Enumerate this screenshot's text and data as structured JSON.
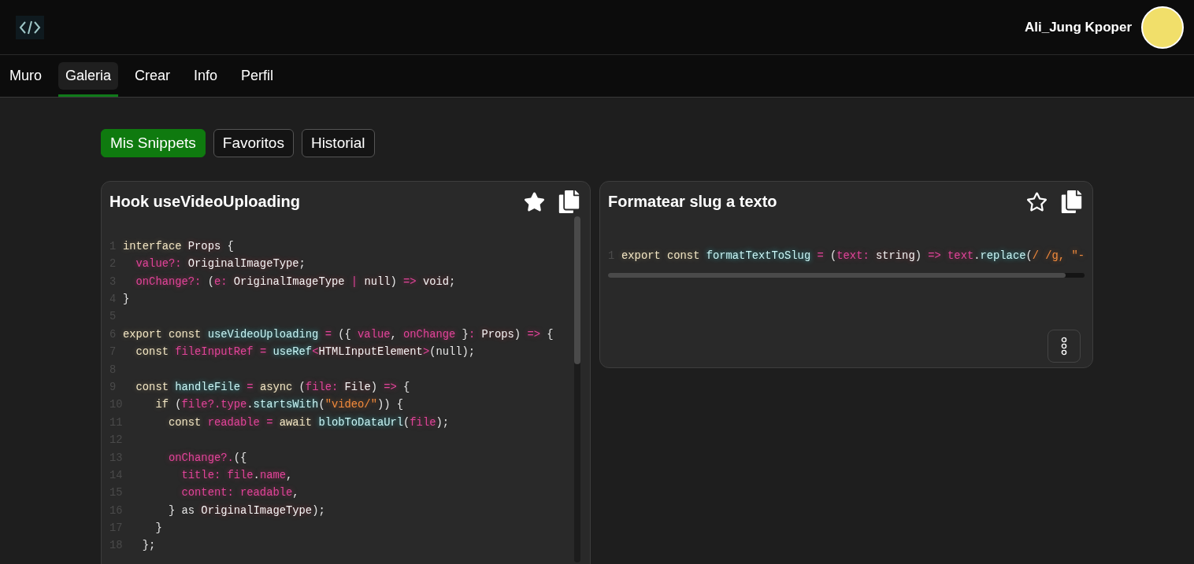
{
  "header": {
    "username": "Ali_Jung Kpoper"
  },
  "nav": [
    {
      "label": "Muro",
      "selected": false
    },
    {
      "label": "Galeria",
      "selected": true
    },
    {
      "label": "Crear",
      "selected": false
    },
    {
      "label": "Info",
      "selected": false
    },
    {
      "label": "Perfil",
      "selected": false
    }
  ],
  "filters": [
    {
      "label": "Mis Snippets",
      "selected": true
    },
    {
      "label": "Favoritos",
      "selected": false
    },
    {
      "label": "Historial",
      "selected": false
    }
  ],
  "snippets": [
    {
      "title": "Hook useVideoUploading",
      "favorite": true,
      "kind": "vertical",
      "lines": [
        {
          "number": "1",
          "tokens": [
            {
              "text": "interface ",
              "kind": "keyword"
            },
            {
              "text": "Props",
              "kind": "type"
            },
            {
              "text": " {",
              "kind": "punctuation"
            }
          ]
        },
        {
          "number": "2",
          "tokens": [
            {
              "text": "  value?: ",
              "kind": "variable"
            },
            {
              "text": "OriginalImageType",
              "kind": "type"
            },
            {
              "text": ";",
              "kind": "punctuation"
            }
          ]
        },
        {
          "number": "3",
          "tokens": [
            {
              "text": "  onChange?: ",
              "kind": "variable"
            },
            {
              "text": "(",
              "kind": "punctuation"
            },
            {
              "text": "e: ",
              "kind": "variable"
            },
            {
              "text": "OriginalImageType",
              "kind": "type"
            },
            {
              "text": " | ",
              "kind": "variable"
            },
            {
              "text": "null",
              "kind": "type"
            },
            {
              "text": ") ",
              "kind": "punctuation"
            },
            {
              "text": "=> ",
              "kind": "variable"
            },
            {
              "text": "void",
              "kind": "type"
            },
            {
              "text": ";",
              "kind": "punctuation"
            }
          ]
        },
        {
          "number": "4",
          "tokens": [
            {
              "text": "}",
              "kind": "punctuation"
            }
          ]
        },
        {
          "number": "5"
        },
        {
          "number": "6",
          "tokens": [
            {
              "text": "export const ",
              "kind": "keyword"
            },
            {
              "text": "useVideoUploading",
              "kind": "function"
            },
            {
              "text": " = ",
              "kind": "variable"
            },
            {
              "text": "({ ",
              "kind": "punctuation"
            },
            {
              "text": "value",
              "kind": "variable"
            },
            {
              "text": ", ",
              "kind": "punctuation"
            },
            {
              "text": "onChange",
              "kind": "variable"
            },
            {
              "text": " }",
              "kind": "punctuation"
            },
            {
              "text": ": ",
              "kind": "variable"
            },
            {
              "text": "Props",
              "kind": "type"
            },
            {
              "text": ") ",
              "kind": "punctuation"
            },
            {
              "text": "=>",
              "kind": "variable"
            },
            {
              "text": " {",
              "kind": "punctuation"
            }
          ]
        },
        {
          "number": "7",
          "tokens": [
            {
              "text": "  const ",
              "kind": "keyword"
            },
            {
              "text": "fileInputRef",
              "kind": "variable"
            },
            {
              "text": " = ",
              "kind": "variable"
            },
            {
              "text": "useRef",
              "kind": "function"
            },
            {
              "text": "<",
              "kind": "variable"
            },
            {
              "text": "HTMLInputElement",
              "kind": "type"
            },
            {
              "text": ">",
              "kind": "variable"
            },
            {
              "text": "(null);",
              "kind": "punctuation"
            }
          ]
        },
        {
          "number": "8"
        },
        {
          "number": "9",
          "tokens": [
            {
              "text": "  const ",
              "kind": "keyword"
            },
            {
              "text": "handleFile",
              "kind": "function"
            },
            {
              "text": " = ",
              "kind": "variable"
            },
            {
              "text": "async",
              "kind": "keyword"
            },
            {
              "text": " (",
              "kind": "punctuation"
            },
            {
              "text": "file: ",
              "kind": "variable"
            },
            {
              "text": "File",
              "kind": "type"
            },
            {
              "text": ") ",
              "kind": "punctuation"
            },
            {
              "text": "=>",
              "kind": "variable"
            },
            {
              "text": " {",
              "kind": "punctuation"
            }
          ]
        },
        {
          "number": "10",
          "tokens": [
            {
              "text": "     if",
              "kind": "keyword"
            },
            {
              "text": " (",
              "kind": "punctuation"
            },
            {
              "text": "file?.type",
              "kind": "variable"
            },
            {
              "text": ".",
              "kind": "punctuation"
            },
            {
              "text": "startsWith",
              "kind": "function"
            },
            {
              "text": "(",
              "kind": "punctuation"
            },
            {
              "text": "\"video/\"",
              "kind": "string"
            },
            {
              "text": ")) {",
              "kind": "punctuation"
            }
          ]
        },
        {
          "number": "11",
          "tokens": [
            {
              "text": "       const ",
              "kind": "keyword"
            },
            {
              "text": "readable",
              "kind": "variable"
            },
            {
              "text": " = ",
              "kind": "variable"
            },
            {
              "text": "await ",
              "kind": "keyword"
            },
            {
              "text": "blobToDataUrl",
              "kind": "function"
            },
            {
              "text": "(",
              "kind": "punctuation"
            },
            {
              "text": "file",
              "kind": "variable"
            },
            {
              "text": ");",
              "kind": "punctuation"
            }
          ]
        },
        {
          "number": "12"
        },
        {
          "number": "13",
          "tokens": [
            {
              "text": "       onChange?.",
              "kind": "variable"
            },
            {
              "text": "({",
              "kind": "punctuation"
            }
          ]
        },
        {
          "number": "14",
          "tokens": [
            {
              "text": "         title: file",
              "kind": "variable"
            },
            {
              "text": ".",
              "kind": "punctuation"
            },
            {
              "text": "name",
              "kind": "variable"
            },
            {
              "text": ",",
              "kind": "punctuation"
            }
          ]
        },
        {
          "number": "15",
          "tokens": [
            {
              "text": "         content: readable",
              "kind": "variable"
            },
            {
              "text": ",",
              "kind": "punctuation"
            }
          ]
        },
        {
          "number": "16",
          "tokens": [
            {
              "text": "       } as ",
              "kind": "punctuation"
            },
            {
              "text": "OriginalImageType",
              "kind": "type"
            },
            {
              "text": ");",
              "kind": "punctuation"
            }
          ]
        },
        {
          "number": "17",
          "tokens": [
            {
              "text": "     }",
              "kind": "punctuation"
            }
          ]
        },
        {
          "number": "18",
          "tokens": [
            {
              "text": "   };",
              "kind": "punctuation"
            }
          ]
        }
      ]
    },
    {
      "title": "Formatear slug a texto",
      "favorite": false,
      "kind": "horizontal",
      "lines": [
        {
          "number": "1",
          "tokens": [
            {
              "text": "export const ",
              "kind": "keyword"
            },
            {
              "text": "formatTextToSlug",
              "kind": "function"
            },
            {
              "text": " = ",
              "kind": "variable"
            },
            {
              "text": "(",
              "kind": "punctuation"
            },
            {
              "text": "text: ",
              "kind": "variable"
            },
            {
              "text": "string",
              "kind": "type"
            },
            {
              "text": ") ",
              "kind": "punctuation"
            },
            {
              "text": "=> ",
              "kind": "variable"
            },
            {
              "text": "text",
              "kind": "variable"
            },
            {
              "text": ".",
              "kind": "punctuation"
            },
            {
              "text": "replace",
              "kind": "function"
            },
            {
              "text": "(",
              "kind": "punctuation"
            },
            {
              "text": "/ /g, \"-",
              "kind": "string"
            }
          ]
        }
      ]
    }
  ]
}
